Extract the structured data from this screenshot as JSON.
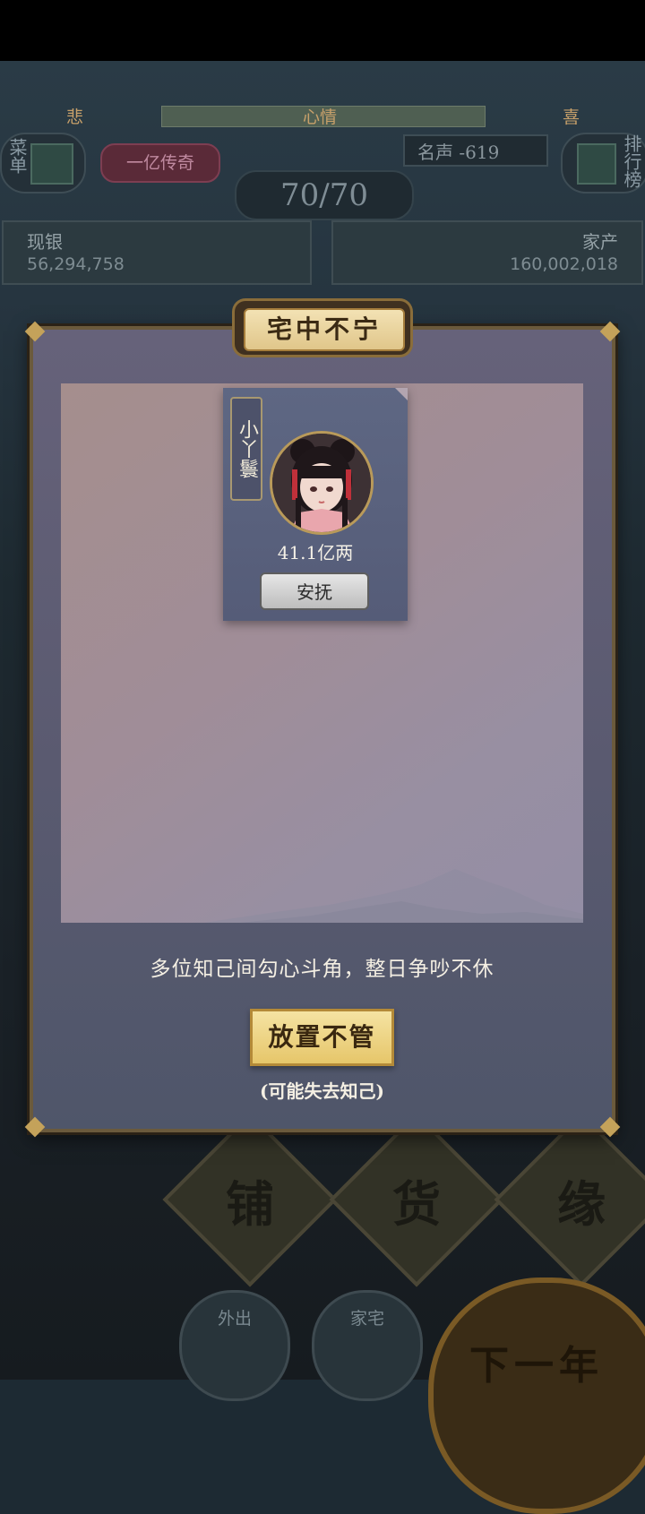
{
  "hud": {
    "mood_bad": "悲",
    "mood_label": "心情",
    "mood_good": "喜",
    "menu_label": "菜单",
    "title_badge": "一亿传奇",
    "fame": "名声 -619",
    "ranking_label": "排行榜",
    "energy": "70/70",
    "cash_label": "现银",
    "cash_value": "56,294,758",
    "assets_label": "家产",
    "assets_value": "160,002,018"
  },
  "modal": {
    "title": "宅中不宁",
    "card": {
      "name": "小丫鬟",
      "price": "41.1亿两",
      "soothe_label": "安抚"
    },
    "message": "多位知己间勾心斗角，整日争吵不休",
    "ignore_label": "放置不管",
    "warning": "(可能失去知己)"
  },
  "bottom": {
    "tile_shop": "铺",
    "tile_goods": "货",
    "tile_fate": "缘",
    "nav_outing": "外出",
    "nav_home": "家宅",
    "next_year": "下一年"
  },
  "colors": {
    "accent_gold": "#e6c66a",
    "modal_bg": "#5a5a70"
  }
}
